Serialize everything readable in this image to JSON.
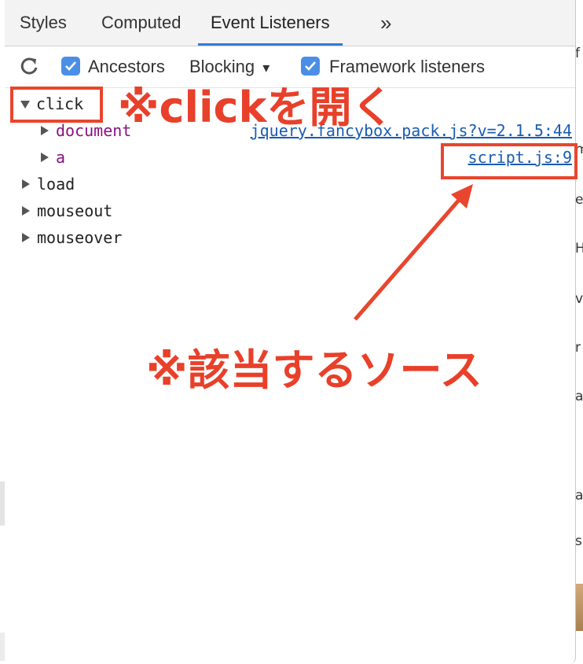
{
  "tabs": [
    {
      "label": "Styles",
      "active": false
    },
    {
      "label": "Computed",
      "active": false
    },
    {
      "label": "Event Listeners",
      "active": true
    },
    {
      "label": "»",
      "active": false
    }
  ],
  "toolbar": {
    "refresh_icon": "refresh-icon",
    "ancestors_label": "Ancestors",
    "ancestors_checked": true,
    "blocking_label": "Blocking",
    "blocking_arrow": "▾",
    "framework_label": "Framework listeners",
    "framework_checked": true
  },
  "events": [
    {
      "name": "click",
      "expanded": true,
      "children": [
        {
          "node": "document",
          "source": "jquery.fancybox.pack.js?v=2.1.5:44"
        },
        {
          "node": "a",
          "source": "script.js:9"
        }
      ]
    },
    {
      "name": "load",
      "expanded": false
    },
    {
      "name": "mouseout",
      "expanded": false
    },
    {
      "name": "mouseover",
      "expanded": false
    }
  ],
  "annotations": {
    "open_click": "※clickを開く",
    "source_note": "※該当するソース"
  },
  "background_fragments": [
    "f",
    "m",
    "e",
    "H",
    "v",
    "r",
    "a",
    "a",
    "s"
  ],
  "colors": {
    "accent": "#3879d9",
    "annotation_red": "#e8462e",
    "link_blue": "#1a5cb0",
    "node_purple": "#881280"
  }
}
